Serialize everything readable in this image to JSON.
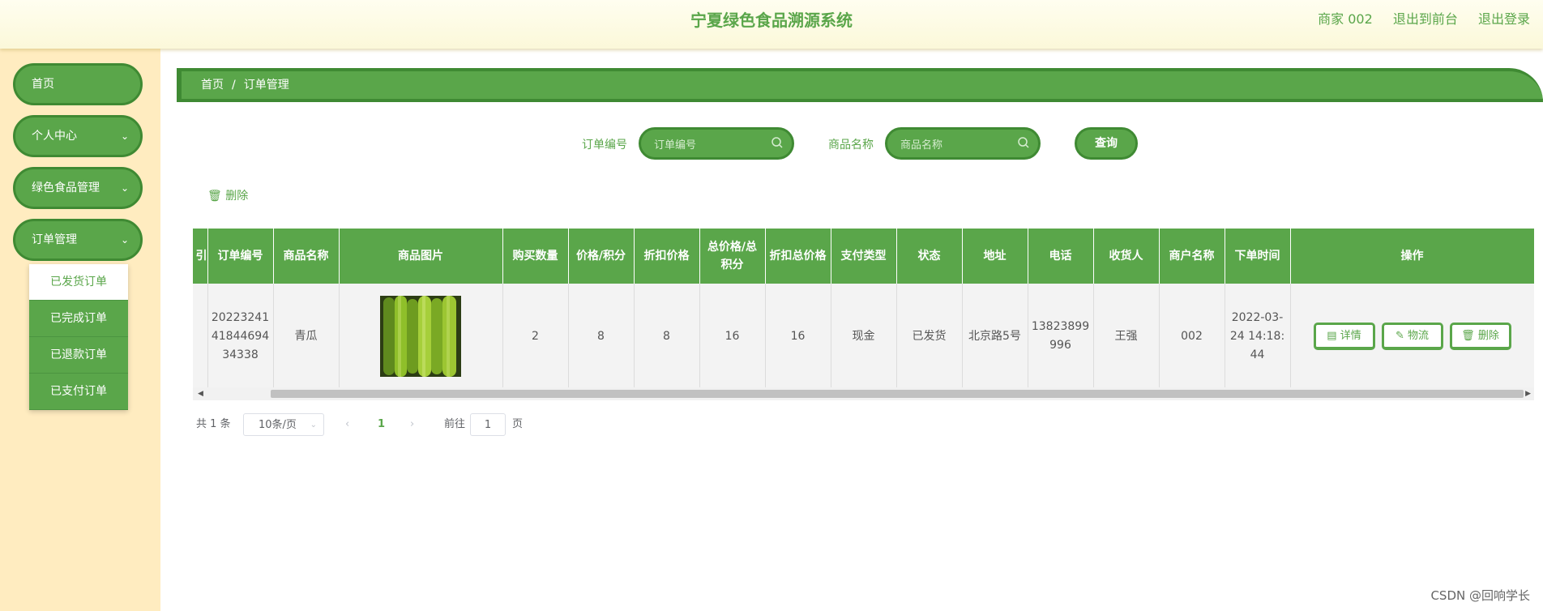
{
  "header": {
    "title": "宁夏绿色食品溯源系统",
    "user": "商家 002",
    "back_to_front": "退出到前台",
    "logout": "退出登录"
  },
  "sidebar": {
    "items": [
      {
        "label": "首页",
        "has_children": false
      },
      {
        "label": "个人中心",
        "has_children": true
      },
      {
        "label": "绿色食品管理",
        "has_children": true
      },
      {
        "label": "订单管理",
        "has_children": true
      }
    ],
    "submenu": [
      "已发货订单",
      "已完成订单",
      "已退款订单",
      "已支付订单"
    ],
    "active_submenu": "已发货订单"
  },
  "breadcrumb": {
    "home": "首页",
    "separator": "/",
    "current": "订单管理"
  },
  "search": {
    "order_no_label": "订单编号",
    "order_no_placeholder": "订单编号",
    "product_label": "商品名称",
    "product_placeholder": "商品名称",
    "query_button": "查询"
  },
  "toolbar": {
    "delete_label": "删除"
  },
  "table": {
    "columns": [
      "引",
      "订单编号",
      "商品名称",
      "商品图片",
      "购买数量",
      "价格/积分",
      "折扣价格",
      "总价格/总积分",
      "折扣总价格",
      "支付类型",
      "状态",
      "地址",
      "电话",
      "收货人",
      "商户名称",
      "下单时间",
      "操作"
    ],
    "rows": [
      {
        "order_no": "202232414184469434338",
        "product": "青瓜",
        "image_icon": "cucumber-photo",
        "quantity": "2",
        "price": "8",
        "discount_price": "8",
        "total": "16",
        "discount_total": "16",
        "pay_type": "现金",
        "status": "已发货",
        "address": "北京路5号",
        "phone": "13823899996",
        "receiver": "王强",
        "merchant": "002",
        "order_time": "2022-03-24 14:18:44"
      }
    ],
    "actions": {
      "detail": "详情",
      "logistics": "物流",
      "delete": "删除"
    }
  },
  "pagination": {
    "total": "共 1 条",
    "page_size": "10条/页",
    "current_page": "1",
    "goto_label": "前往",
    "goto_value": "1",
    "page_suffix": "页"
  },
  "watermark": "CSDN @回响学长",
  "colors": {
    "accent": "#5aa64a",
    "accent_dark": "#3f8a33",
    "sidebar_bg": "#ffecc0",
    "header_bg": "#fdfbe4"
  }
}
